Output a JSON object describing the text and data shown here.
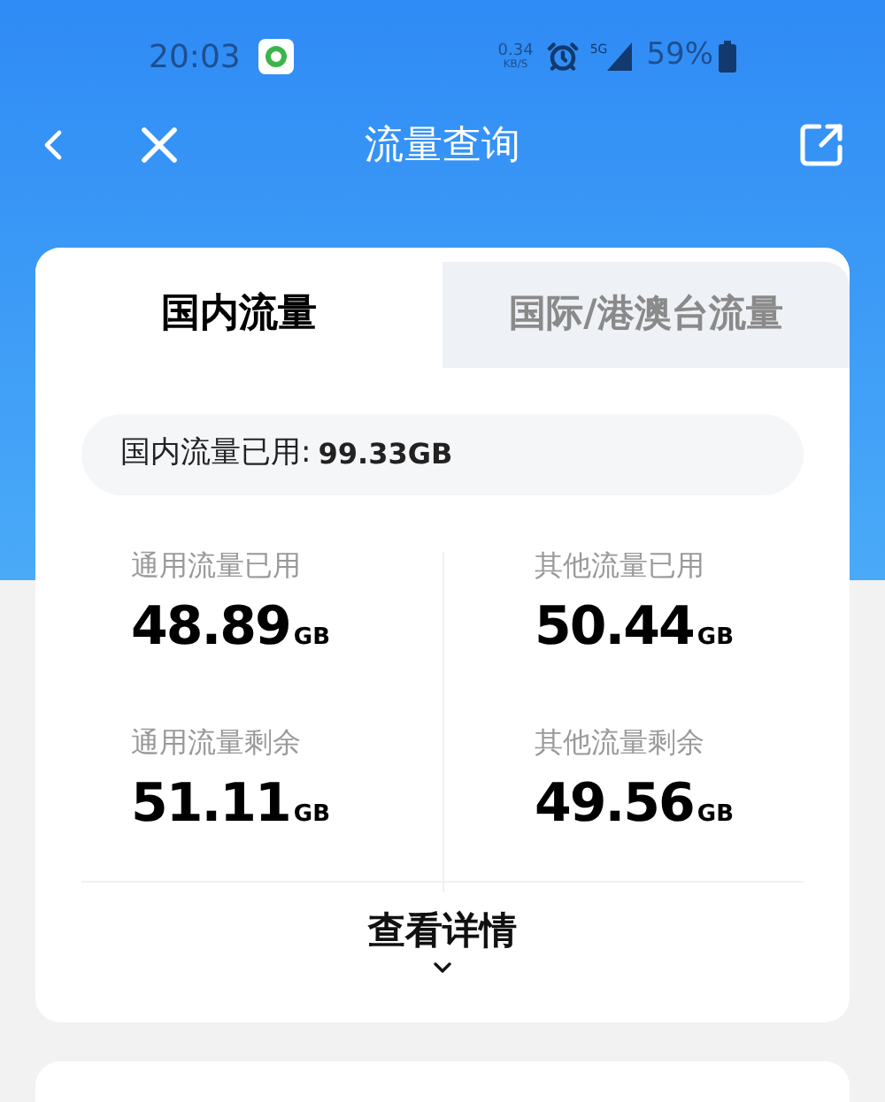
{
  "status_bar": {
    "time": "20:03",
    "speed": "0.34",
    "speed_unit": "KB/S",
    "network": "5G",
    "battery": "59%"
  },
  "nav": {
    "title": "流量查询"
  },
  "tabs": [
    {
      "label": "国内流量",
      "selected": true
    },
    {
      "label": "国际/港澳台流量",
      "selected": false
    }
  ],
  "summary": {
    "label": "国内流量已用:",
    "value": "99.33GB"
  },
  "stats": [
    {
      "label": "通用流量已用",
      "value": "48.89",
      "unit": "GB"
    },
    {
      "label": "其他流量已用",
      "value": "50.44",
      "unit": "GB"
    },
    {
      "label": "通用流量剩余",
      "value": "51.11",
      "unit": "GB"
    },
    {
      "label": "其他流量剩余",
      "value": "49.56",
      "unit": "GB"
    }
  ],
  "details_button": {
    "label": "查看详情"
  }
}
